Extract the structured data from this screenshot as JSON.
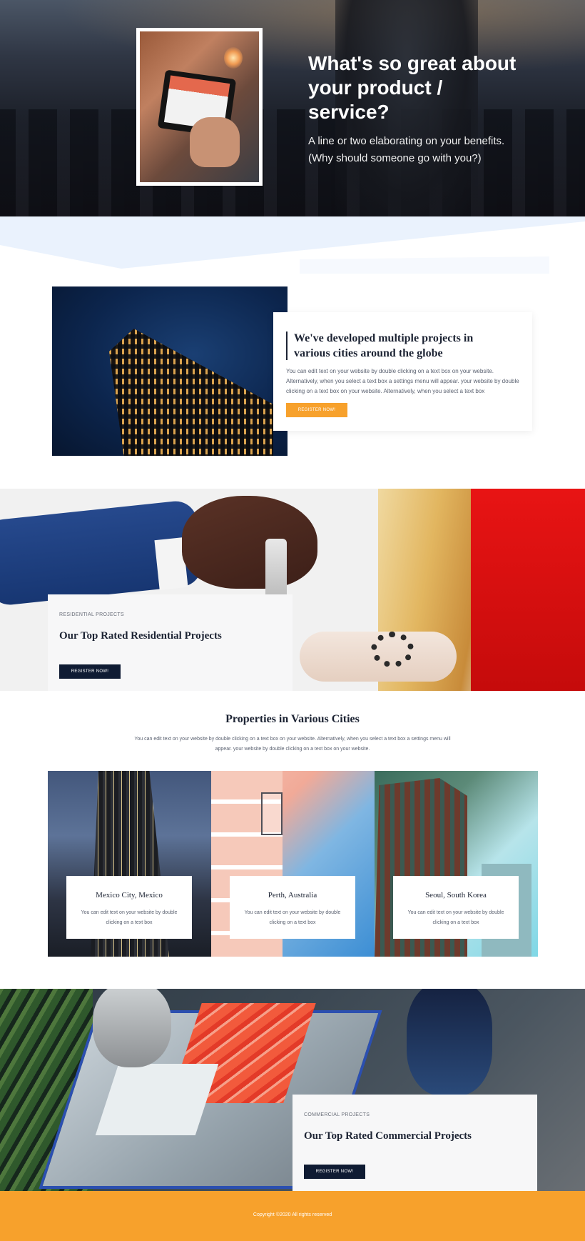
{
  "hero": {
    "title": "What's so great about your product / service?",
    "subtitle": "A line or two elaborating on your benefits. (Why should someone go with you?)"
  },
  "intro": {
    "title": "We've developed multiple projects in various cities around the globe",
    "body": "You can edit text on your website by double clicking on a text box on your website. Alternatively, when you select a text box a settings menu will appear. your website by double clicking on a text box on your website. Alternatively, when you select a text box",
    "button_label": "REGISTER NOW!"
  },
  "residential": {
    "eyebrow": "RESIDENTIAL PROJECTS",
    "title": "Our Top Rated Residential Projects",
    "button_label": "REGISTER NOW!"
  },
  "cities": {
    "title": "Properties in Various Cities",
    "body": "You can edit text on your website by double clicking on a text box on your website. Alternatively, when you select a text box a settings menu will appear. your website by double clicking on a text box on your website.",
    "items": [
      {
        "name": "Mexico City, Mexico",
        "text": "You can edit text on your website by double clicking on a text box"
      },
      {
        "name": "Perth, Australia",
        "text": "You can edit text on your website by double clicking on a text box"
      },
      {
        "name": "Seoul, South Korea",
        "text": "You can edit text on your website by double clicking on a text box"
      }
    ]
  },
  "commercial": {
    "eyebrow": "COMMERCIAL PROJECTS",
    "title": "Our Top Rated Commercial Projects",
    "button_label": "REGISTER NOW!"
  },
  "footer": {
    "copyright": "Copyright ©2020 All rights reserved"
  },
  "colors": {
    "accent": "#f7a12c",
    "navy": "#0f1b33",
    "band": "#eaf2fd"
  }
}
